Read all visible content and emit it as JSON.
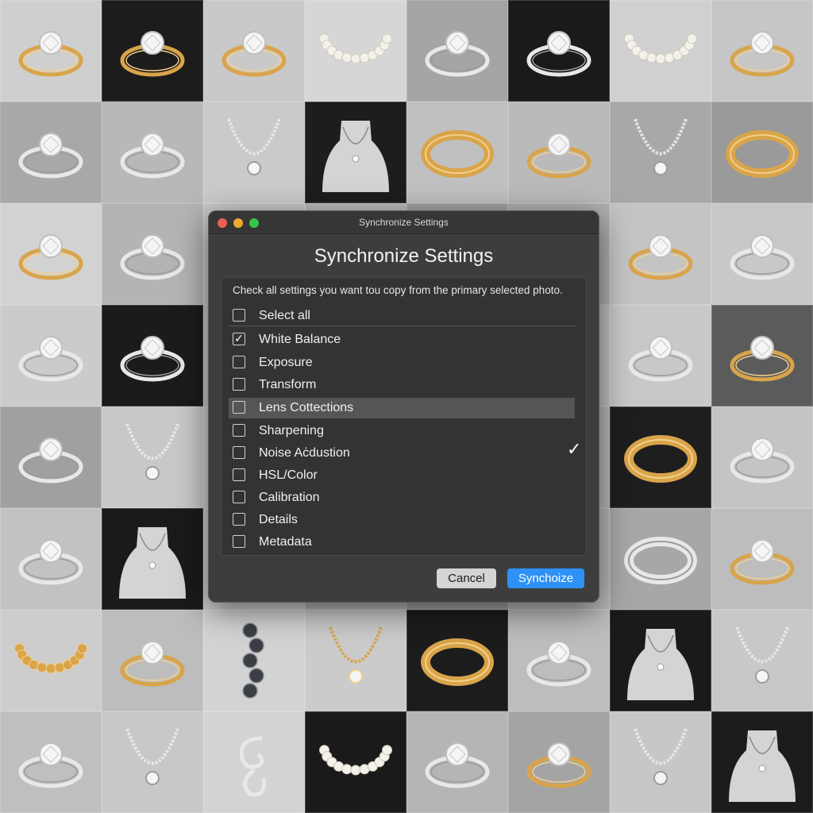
{
  "dialog": {
    "window_title": "Synchronize Settings",
    "heading": "Synchronize Settings",
    "instructions": "Check all settings you want tou copy from the primary selected photo.",
    "traffic_lights": {
      "close": "#ed5f55",
      "minimize": "#f0a930",
      "zoom": "#34c749"
    },
    "options": [
      {
        "label": "Select all",
        "checked": false
      },
      {
        "label": "White Balance",
        "checked": true
      },
      {
        "label": "Exposure",
        "checked": false
      },
      {
        "label": "Transform",
        "checked": false
      },
      {
        "label": "Lens Cottections",
        "checked": false,
        "highlighted": true
      },
      {
        "label": "Sharpening",
        "checked": false
      },
      {
        "label": "Noise Aċdustion",
        "checked": false
      },
      {
        "label": "HSL/Color",
        "checked": false
      },
      {
        "label": "Calibration",
        "checked": false
      },
      {
        "label": "Details",
        "checked": false
      },
      {
        "label": "Metadata",
        "checked": false
      }
    ],
    "side_checkmark": "✓",
    "buttons": {
      "cancel": "Cancel",
      "synchronize": "Synchoize"
    },
    "accent_color": "#2e91f5"
  },
  "background_grid": {
    "rows": 8,
    "cols": 8,
    "tiles": [
      {
        "bg": "#cfcfcf",
        "item": "ring",
        "metal": "gold"
      },
      {
        "bg": "#1c1c1c",
        "item": "ring",
        "metal": "gold"
      },
      {
        "bg": "#c9c9c9",
        "item": "ring",
        "metal": "gold"
      },
      {
        "bg": "#d6d6d6",
        "item": "pearls",
        "metal": "pearl"
      },
      {
        "bg": "#a5a5a5",
        "item": "ring",
        "metal": "silver"
      },
      {
        "bg": "#1a1a1a",
        "item": "ring",
        "metal": "silver"
      },
      {
        "bg": "#d0d0d0",
        "item": "pearls",
        "metal": "pearl"
      },
      {
        "bg": "#c6c6c6",
        "item": "ring",
        "metal": "gold"
      },
      {
        "bg": "#a8a8a8",
        "item": "ring",
        "metal": "silver"
      },
      {
        "bg": "#b8b8b8",
        "item": "ring",
        "metal": "silver"
      },
      {
        "bg": "#cacaca",
        "item": "necklace",
        "metal": "silver"
      },
      {
        "bg": "#1d1d1d",
        "item": "bust",
        "metal": "silver"
      },
      {
        "bg": "#c0c0c0",
        "item": "band",
        "metal": "gold"
      },
      {
        "bg": "#bababa",
        "item": "ring",
        "metal": "gold"
      },
      {
        "bg": "#a8a8a8",
        "item": "necklace",
        "metal": "silver"
      },
      {
        "bg": "#9a9a9a",
        "item": "band",
        "metal": "gold"
      },
      {
        "bg": "#d2d2d2",
        "item": "ring",
        "metal": "gold"
      },
      {
        "bg": "#b4b4b4",
        "item": "ring",
        "metal": "silver"
      },
      {
        "bg": "#c8c8c8",
        "item": "ring",
        "metal": "silver"
      },
      {
        "bg": "#bcbcbc",
        "item": "ring",
        "metal": "silver"
      },
      {
        "bg": "#a4a4a4",
        "item": "ring",
        "metal": "silver"
      },
      {
        "bg": "#b0b0b0",
        "item": "ring",
        "metal": "silver"
      },
      {
        "bg": "#c4c4c4",
        "item": "ring",
        "metal": "gold"
      },
      {
        "bg": "#c8c8c8",
        "item": "ring",
        "metal": "silver"
      },
      {
        "bg": "#cbcbcb",
        "item": "ring",
        "metal": "silver"
      },
      {
        "bg": "#1b1b1b",
        "item": "ring",
        "metal": "silver"
      },
      {
        "bg": "#c6c6c6",
        "item": "ring",
        "metal": "silver"
      },
      {
        "bg": "#b6b6b6",
        "item": "ring",
        "metal": "silver"
      },
      {
        "bg": "#a6a6a6",
        "item": "ring",
        "metal": "silver"
      },
      {
        "bg": "#bfbfbf",
        "item": "ring",
        "metal": "silver"
      },
      {
        "bg": "#c8c8c8",
        "item": "ring",
        "metal": "silver"
      },
      {
        "bg": "#5b5b5b",
        "item": "ring",
        "metal": "gold"
      },
      {
        "bg": "#a0a0a0",
        "item": "ring",
        "metal": "silver"
      },
      {
        "bg": "#c8c8c8",
        "item": "pendant",
        "metal": "silver"
      },
      {
        "bg": "#cdcdcd",
        "item": "ring",
        "metal": "silver"
      },
      {
        "bg": "#b9b9b9",
        "item": "ring",
        "metal": "silver"
      },
      {
        "bg": "#a4a4a4",
        "item": "ring",
        "metal": "silver"
      },
      {
        "bg": "#b8b8b8",
        "item": "ring",
        "metal": "silver"
      },
      {
        "bg": "#1e1e1e",
        "item": "band",
        "metal": "gold"
      },
      {
        "bg": "#c4c4c4",
        "item": "ring",
        "metal": "silver"
      },
      {
        "bg": "#c2c2c2",
        "item": "ring",
        "metal": "silver"
      },
      {
        "bg": "#1a1a1a",
        "item": "bust",
        "metal": "silver"
      },
      {
        "bg": "#cbcbcb",
        "item": "ring",
        "metal": "silver"
      },
      {
        "bg": "#b7b7b7",
        "item": "ring",
        "metal": "silver"
      },
      {
        "bg": "#a3a3a3",
        "item": "ring",
        "metal": "silver"
      },
      {
        "bg": "#b9b9b9",
        "item": "ring",
        "metal": "silver"
      },
      {
        "bg": "#a7a7a7",
        "item": "band",
        "metal": "silver"
      },
      {
        "bg": "#bdbdbd",
        "item": "ring",
        "metal": "gold"
      },
      {
        "bg": "#cdcdcd",
        "item": "pearls",
        "metal": "gold"
      },
      {
        "bg": "#bdbdbd",
        "item": "ring",
        "metal": "gold"
      },
      {
        "bg": "#d3d3d3",
        "item": "beads",
        "metal": "dark"
      },
      {
        "bg": "#cbcbcb",
        "item": "pendant",
        "metal": "gold"
      },
      {
        "bg": "#1c1c1c",
        "item": "band",
        "metal": "gold"
      },
      {
        "bg": "#bdbdbd",
        "item": "ring",
        "metal": "silver"
      },
      {
        "bg": "#1a1a1a",
        "item": "bust",
        "metal": "silver"
      },
      {
        "bg": "#c8c8c8",
        "item": "necklace",
        "metal": "silver"
      },
      {
        "bg": "#bfbfbf",
        "item": "ring",
        "metal": "silver"
      },
      {
        "bg": "#c8c8c8",
        "item": "pendant",
        "metal": "silver"
      },
      {
        "bg": "#d3d3d3",
        "item": "swirl",
        "metal": "silver"
      },
      {
        "bg": "#1a1a1a",
        "item": "pearls",
        "metal": "pearl"
      },
      {
        "bg": "#b5b5b5",
        "item": "ring",
        "metal": "silver"
      },
      {
        "bg": "#a4a4a4",
        "item": "ring",
        "metal": "gold"
      },
      {
        "bg": "#c7c7c7",
        "item": "necklace",
        "metal": "silver"
      },
      {
        "bg": "#1c1c1c",
        "item": "bust",
        "metal": "silver"
      }
    ]
  }
}
